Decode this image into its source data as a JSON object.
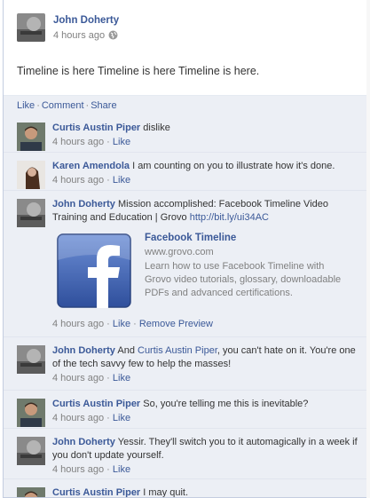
{
  "post": {
    "author": "John Doherty",
    "time": "4 hours ago",
    "icon": "globe-icon",
    "text": "Timeline is here Timeline is here Timeline is here."
  },
  "actions": {
    "like": "Like",
    "comment": "Comment",
    "share": "Share",
    "separator": "·"
  },
  "comments": [
    {
      "name": "Curtis Austin Piper",
      "text": "dislike",
      "time": "4 hours ago",
      "like": "Like"
    },
    {
      "name": "Karen Amendola",
      "text": "I am counting on you to illustrate how it's done.",
      "time": "4 hours ago",
      "like": "Like"
    },
    {
      "name": "John Doherty",
      "text": "Mission accomplished: Facebook Timeline Video Training and Education | Grovo",
      "link": "http://bit.ly/ui34AC",
      "time": "4 hours ago",
      "like": "Like",
      "remove": "Remove Preview",
      "attachment": {
        "title": "Facebook Timeline",
        "url": "www.grovo.com",
        "description": "Learn how to use Facebook Timeline with Grovo video tutorials, glossary, downloadable PDFs and advanced certifications."
      }
    },
    {
      "name": "John Doherty",
      "text_before": "And",
      "mention": "Curtis Austin Piper",
      "text_after": ", you can't hate on it. You're one of the tech savvy few to help the masses!",
      "time": "4 hours ago",
      "like": "Like"
    },
    {
      "name": "Curtis Austin Piper",
      "text": "So, you're telling me this is inevitable?",
      "time": "4 hours ago",
      "like": "Like"
    },
    {
      "name": "John Doherty",
      "text": "Yessir. They'll switch you to it automagically in a week if you don't update yourself.",
      "time": "4 hours ago",
      "like": "Like"
    },
    {
      "name": "Curtis Austin Piper",
      "text": "I may quit.",
      "time": "",
      "like": ""
    }
  ],
  "colors": {
    "link": "#3b5998",
    "comment_bg": "#eceff5",
    "meta": "#808080"
  }
}
